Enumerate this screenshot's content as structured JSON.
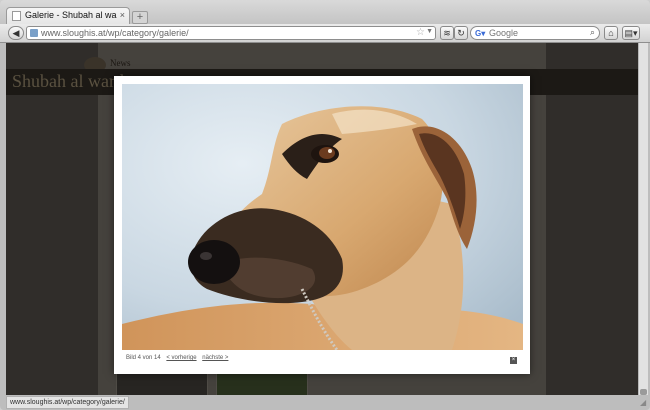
{
  "browser": {
    "tab": {
      "title": "Galerie - Shubah al warda - Slo...",
      "close_label": "×"
    },
    "new_tab_label": "+",
    "back_label": "◀",
    "address_url": "www.sloughis.at/wp/category/galerie/",
    "search_placeholder": "Google",
    "reload_label": "↻",
    "home_label": "⌂",
    "menu_label": "▤▾"
  },
  "page": {
    "site_title": "Shubah al warda",
    "nav_text": "News"
  },
  "lightbox": {
    "caption": "Bild 4 von 14",
    "prev_label": "< vorherige",
    "next_label": "nächste >",
    "close_label": "×"
  },
  "status_bar": {
    "url": "www.sloughis.at/wp/category/galerie/"
  },
  "colors": {
    "page_background": "#4a4641",
    "header_band": "#2b2721",
    "site_title": "#8a7d63"
  }
}
